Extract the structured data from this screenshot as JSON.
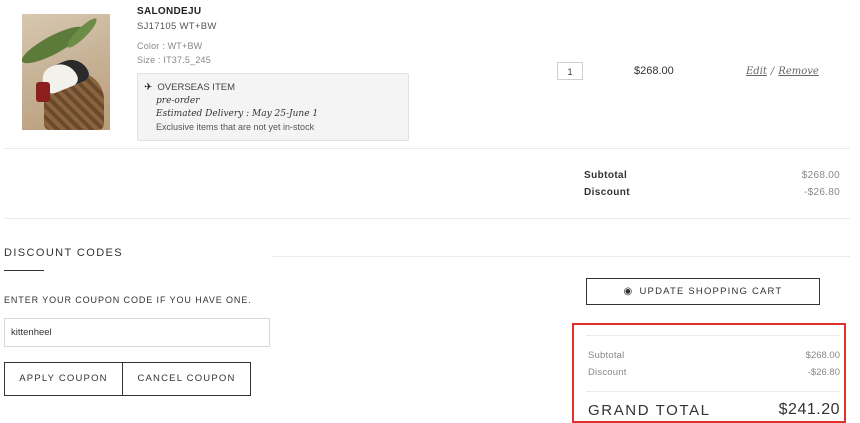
{
  "item": {
    "brand": "SALONDEJU",
    "sku": "SJ17105 WT+BW",
    "color": "Color : WT+BW",
    "size": "Size : IT37.5_245",
    "overseas_title": "OVERSEAS ITEM",
    "preorder": "pre-order",
    "delivery": "Estimated Delivery : May 25-June 1",
    "exclusive": "Exclusive items that are not yet in-stock",
    "qty": "1",
    "price": "$268.00",
    "edit_label": "Edit",
    "separator": "/",
    "remove_label": "Remove"
  },
  "summary": {
    "subtotal_label": "Subtotal",
    "subtotal_value": "$268.00",
    "discount_label": "Discount",
    "discount_value": "-$26.80"
  },
  "discount_codes": {
    "title": "DISCOUNT CODES",
    "instruction": "ENTER YOUR COUPON CODE IF YOU HAVE ONE.",
    "coupon_value": "kittenheel",
    "apply_label": "APPLY COUPON",
    "cancel_label": "CANCEL COUPON"
  },
  "cart": {
    "update_label": "UPDATE SHOPPING CART"
  },
  "totals": {
    "subtotal_label": "Subtotal",
    "subtotal_value": "$268.00",
    "discount_label": "Discount",
    "discount_value": "-$26.80",
    "grand_total_label": "GRAND TOTAL",
    "grand_total_value": "$241.20"
  },
  "colors": {
    "highlight_border": "#e0322b",
    "overseas_bg": "#f4f4f4"
  },
  "icons": {
    "overseas": "airplane-icon",
    "update": "target-icon"
  }
}
